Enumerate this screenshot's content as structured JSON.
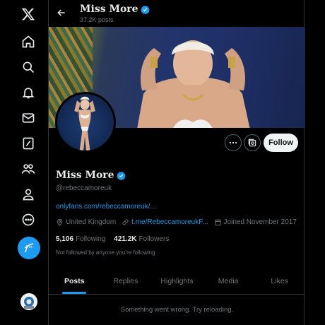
{
  "nav": {
    "items": [
      "x-logo",
      "home",
      "explore",
      "notifications",
      "messages",
      "grok",
      "communities",
      "profile",
      "more"
    ],
    "compose_label": "Post"
  },
  "header": {
    "name": "Miss More",
    "posts_count": "37.2K posts"
  },
  "profile": {
    "name": "Miss More",
    "handle": "@rebeccamoreuk",
    "link": "onlyfans.com/rebeccamoreuk/...",
    "location": "United Kingdom",
    "website": "t.me/RebeccamoreukF...",
    "joined": "Joined November 2017",
    "following_count": "5,106",
    "following_label": "Following",
    "followers_count": "421.2K",
    "followers_label": "Followers",
    "follow_context": "Not followed by anyone you’re following",
    "follow_button": "Follow"
  },
  "tabs": [
    {
      "label": "Posts",
      "active": true
    },
    {
      "label": "Replies",
      "active": false
    },
    {
      "label": "Highlights",
      "active": false
    },
    {
      "label": "Media",
      "active": false
    },
    {
      "label": "Likes",
      "active": false
    }
  ],
  "feed": {
    "error_message": "Something went wrong. Try reloading."
  },
  "colors": {
    "accent": "#1d9bf0",
    "background": "#000000",
    "text": "#e7e9ea",
    "muted": "#71767b",
    "border": "#2f3336"
  }
}
